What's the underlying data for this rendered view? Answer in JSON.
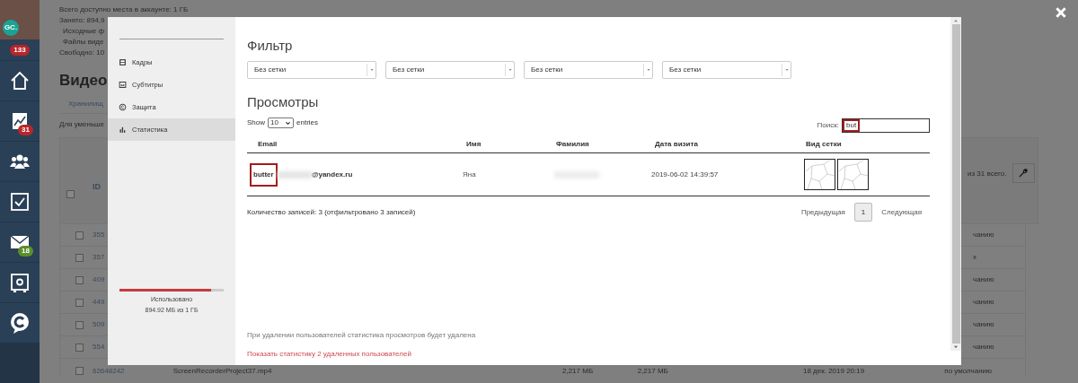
{
  "sidebar": {
    "avatar_badge": "GC.",
    "top_badge": {
      "text": "133",
      "color": "#b8262a"
    },
    "nav": [
      {
        "kind": "home"
      },
      {
        "kind": "chart",
        "badge": {
          "text": "31",
          "color": "#b8262a"
        }
      },
      {
        "kind": "users"
      },
      {
        "kind": "task"
      },
      {
        "kind": "mail",
        "badge": {
          "text": "18",
          "color": "#5a8f2a"
        }
      },
      {
        "kind": "safe"
      },
      {
        "kind": "logo"
      }
    ]
  },
  "page": {
    "storage_lines": [
      "Всего доступно места в аккаунте: 1 ГБ",
      "Занято: 894,9",
      "Исходные ф",
      "Файлы виде",
      "Свободно: 10"
    ],
    "heading": "Видео",
    "header_checked": false,
    "tab": "Хранилищ",
    "hint": "Для уменьше",
    "id_header": "ID",
    "total": "из 31 всего.",
    "rows": [
      {
        "id": "355",
        "checked": false,
        "tail": "чанию"
      },
      {
        "id": "357",
        "checked": false,
        "tail": "х"
      },
      {
        "id": "409",
        "checked": false,
        "tail": "чанию"
      },
      {
        "id": "449",
        "checked": false,
        "tail": "чанию"
      },
      {
        "id": "509",
        "checked": false,
        "tail": "чанию"
      },
      {
        "id": "554",
        "checked": false,
        "tail": "чанию"
      }
    ],
    "last_row": {
      "checked": false,
      "cells": [
        "62648242",
        "ScreenRecorderProject37.mp4",
        "2,217 МБ",
        "2,217 МБ",
        "18 дек. 2019 20:19",
        "по умолчанию"
      ]
    }
  },
  "modal": {
    "menu": [
      {
        "kind": "frames",
        "label": "Кадры",
        "selected": false
      },
      {
        "kind": "subtitles",
        "label": "Субтитры",
        "selected": false
      },
      {
        "kind": "protection",
        "label": "Защита",
        "selected": false
      },
      {
        "kind": "stats",
        "label": "Статистика",
        "selected": true
      }
    ],
    "usage": {
      "level": 0.88,
      "label": "Использовано",
      "value": "894.92 МБ из 1 ГБ"
    },
    "filter_title": "Фильтр",
    "filters": [
      "Без сетки",
      "Без сетки",
      "Без сетки",
      "Без сетки"
    ],
    "views_title": "Просмотры",
    "show_label": "Show",
    "page_size": "10",
    "entries_label": "entries",
    "search_label": "Поиск:",
    "search_value": "but",
    "columns": [
      "Email",
      "Имя",
      "Фамилия",
      "Дата визита",
      "Вид сетки"
    ],
    "rows": [
      {
        "email_match": "butter",
        "email_domain": "@yandex.ru",
        "first_name": "Яна",
        "date": "2019-06-02 14:39:57"
      }
    ],
    "summary": "Количество записей: 3 (отфильтровано 3 записей)",
    "pagination": [
      {
        "label": "Предыдущая",
        "selected": false
      },
      {
        "label": "1",
        "selected": true
      },
      {
        "label": "Следующая",
        "selected": false
      }
    ],
    "note": "При удалении пользователей статистика просмотров будет удалена",
    "deleted_link": "Показать статистику 2 удаленных пользователей"
  }
}
